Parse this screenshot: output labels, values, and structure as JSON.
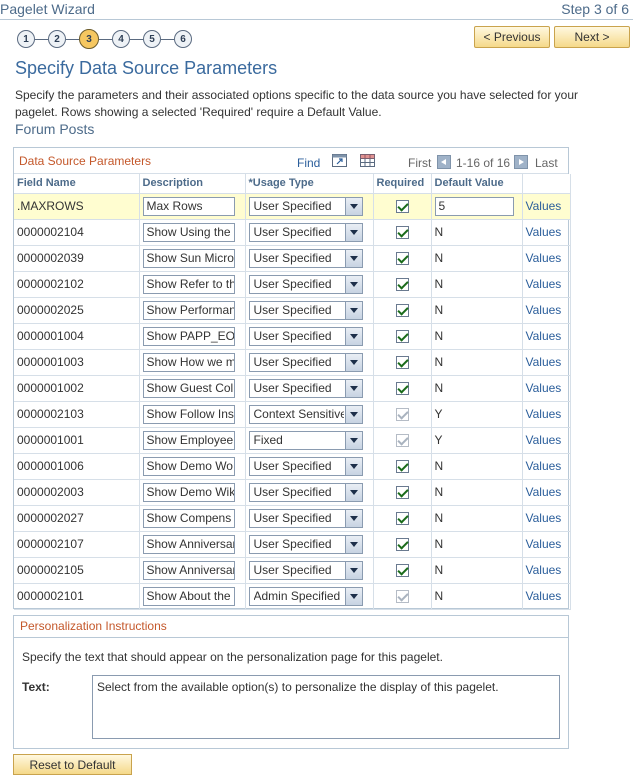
{
  "header": {
    "wizard_title": "Pagelet Wizard",
    "step_label": "Step 3 of 6"
  },
  "steps": [
    "1",
    "2",
    "3",
    "4",
    "5",
    "6"
  ],
  "current_step": 3,
  "nav": {
    "previous_label": "< Previous",
    "next_label": "Next >"
  },
  "page": {
    "title": "Specify Data Source Parameters",
    "instructions": "Specify the parameters and their associated options specific to the data source you have selected for your pagelet.  Rows showing a selected 'Required' require a Default Value.",
    "section_name": "Forum Posts"
  },
  "grid": {
    "title": "Data Source Parameters",
    "find_label": "Find",
    "first_label": "First",
    "range_label": "1-16 of 16",
    "last_label": "Last",
    "columns": [
      "Field Name",
      "Description",
      "*Usage Type",
      "Required",
      "Default Value",
      ""
    ],
    "values_label": "Values",
    "rows": [
      {
        "field": ".MAXROWS",
        "description": "Max Rows",
        "usage": "User Specified",
        "required": true,
        "required_disabled": false,
        "default": "5",
        "default_editable": true
      },
      {
        "field": "0000002104",
        "description": "Show Using the",
        "usage": "User Specified",
        "required": true,
        "required_disabled": false,
        "default": "N",
        "default_editable": false
      },
      {
        "field": "0000002039",
        "description": "Show Sun Micros",
        "usage": "User Specified",
        "required": true,
        "required_disabled": false,
        "default": "N",
        "default_editable": false
      },
      {
        "field": "0000002102",
        "description": "Show Refer to th",
        "usage": "User Specified",
        "required": true,
        "required_disabled": false,
        "default": "N",
        "default_editable": false
      },
      {
        "field": "0000002025",
        "description": "Show Performan",
        "usage": "User Specified",
        "required": true,
        "required_disabled": false,
        "default": "N",
        "default_editable": false
      },
      {
        "field": "0000001004",
        "description": "Show PAPP_EO_",
        "usage": "User Specified",
        "required": true,
        "required_disabled": false,
        "default": "N",
        "default_editable": false
      },
      {
        "field": "0000001003",
        "description": "Show How we m",
        "usage": "User Specified",
        "required": true,
        "required_disabled": false,
        "default": "N",
        "default_editable": false
      },
      {
        "field": "0000001002",
        "description": "Show Guest Col",
        "usage": "User Specified",
        "required": true,
        "required_disabled": false,
        "default": "N",
        "default_editable": false
      },
      {
        "field": "0000002103",
        "description": "Show Follow Ins",
        "usage": "Context Sensitive",
        "required": true,
        "required_disabled": true,
        "default": "Y",
        "default_editable": false
      },
      {
        "field": "0000001001",
        "description": "Show Employee",
        "usage": "Fixed",
        "required": true,
        "required_disabled": true,
        "default": "Y",
        "default_editable": false
      },
      {
        "field": "0000001006",
        "description": "Show Demo Wo",
        "usage": "User Specified",
        "required": true,
        "required_disabled": false,
        "default": "N",
        "default_editable": false
      },
      {
        "field": "0000002003",
        "description": "Show Demo Wik",
        "usage": "User Specified",
        "required": true,
        "required_disabled": false,
        "default": "N",
        "default_editable": false
      },
      {
        "field": "0000002027",
        "description": "Show Compens",
        "usage": "User Specified",
        "required": true,
        "required_disabled": false,
        "default": "N",
        "default_editable": false
      },
      {
        "field": "0000002107",
        "description": "Show Anniversar",
        "usage": "User Specified",
        "required": true,
        "required_disabled": false,
        "default": "N",
        "default_editable": false
      },
      {
        "field": "0000002105",
        "description": "Show Anniversar",
        "usage": "User Specified",
        "required": true,
        "required_disabled": false,
        "default": "N",
        "default_editable": false
      },
      {
        "field": "0000002101",
        "description": "Show About the I",
        "usage": "Admin Specified",
        "required": true,
        "required_disabled": true,
        "default": "N",
        "default_editable": false
      }
    ]
  },
  "personalization": {
    "title": "Personalization Instructions",
    "description": "Specify the text that should appear on the personalization page for this pagelet.",
    "text_label": "Text:",
    "text_value": "Select from the available option(s) to personalize the display of this pagelet."
  },
  "reset_label": "Reset to Default",
  "colors": {
    "accent_title": "#3a6a9e",
    "section_header": "#c4582b",
    "link": "#2b5e9b",
    "highlight_row": "#fffdd0"
  }
}
